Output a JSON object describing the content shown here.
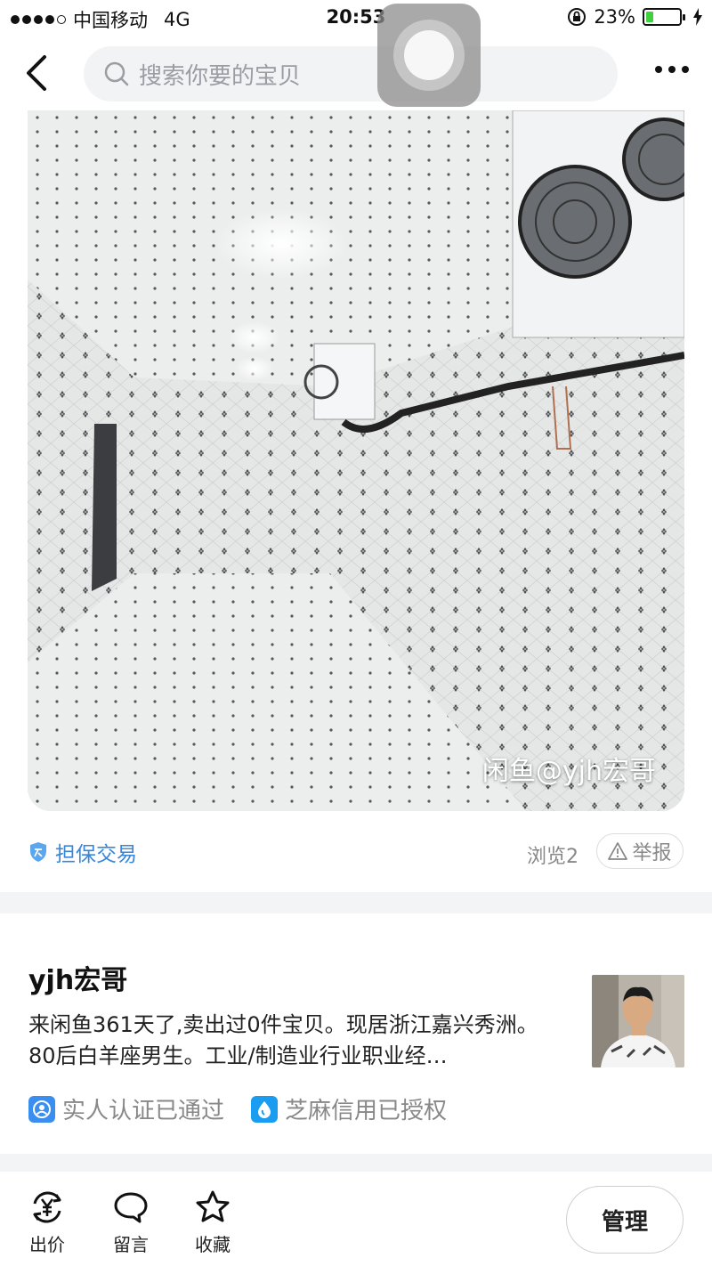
{
  "status_bar": {
    "carrier": "中国移动",
    "network": "4G",
    "time": "20:53",
    "battery_percent": "23%",
    "battery_level": 0.23
  },
  "nav": {
    "search_placeholder": "搜索你要的宝贝"
  },
  "photo": {
    "watermark": "闲鱼@yjh宏哥"
  },
  "info_row": {
    "escrow_label": "担保交易",
    "views_label": "浏览2",
    "report_label": "举报"
  },
  "seller": {
    "name": "yjh宏哥",
    "description": "来闲鱼361天了,卖出过0件宝贝。现居浙江嘉兴秀洲。80后白羊座男生。工业/制造业行业职业经…",
    "badges": [
      {
        "label": "实人认证已通过",
        "icon": "person-verified-icon"
      },
      {
        "label": "芝麻信用已授权",
        "icon": "sesame-credit-icon"
      }
    ]
  },
  "bottom_bar": {
    "actions": [
      {
        "label": "出价",
        "icon": "bid-yuan-icon"
      },
      {
        "label": "留言",
        "icon": "comment-bubble-icon"
      },
      {
        "label": "收藏",
        "icon": "star-icon"
      }
    ],
    "manage_label": "管理"
  },
  "colors": {
    "accent_blue": "#3a86d8",
    "battery_green": "#3fd13f",
    "separator": "#f3f4f6"
  }
}
